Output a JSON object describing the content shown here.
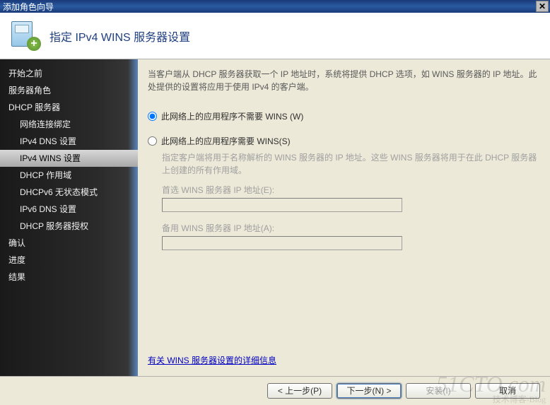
{
  "window": {
    "title": "添加角色向导"
  },
  "header": {
    "title": "指定 IPv4 WINS 服务器设置"
  },
  "sidebar": {
    "items": [
      {
        "label": "开始之前",
        "sub": false,
        "selected": false
      },
      {
        "label": "服务器角色",
        "sub": false,
        "selected": false
      },
      {
        "label": "DHCP 服务器",
        "sub": false,
        "selected": false
      },
      {
        "label": "网络连接绑定",
        "sub": true,
        "selected": false
      },
      {
        "label": "IPv4 DNS 设置",
        "sub": true,
        "selected": false
      },
      {
        "label": "IPv4 WINS 设置",
        "sub": true,
        "selected": true
      },
      {
        "label": "DHCP 作用域",
        "sub": true,
        "selected": false
      },
      {
        "label": "DHCPv6 无状态模式",
        "sub": true,
        "selected": false
      },
      {
        "label": "IPv6 DNS 设置",
        "sub": true,
        "selected": false
      },
      {
        "label": "DHCP 服务器授权",
        "sub": true,
        "selected": false
      },
      {
        "label": "确认",
        "sub": false,
        "selected": false
      },
      {
        "label": "进度",
        "sub": false,
        "selected": false
      },
      {
        "label": "结果",
        "sub": false,
        "selected": false
      }
    ]
  },
  "content": {
    "intro": "当客户端从 DHCP 服务器获取一个 IP 地址时，系统将提供 DHCP 选项，如 WINS 服务器的 IP 地址。此处提供的设置将应用于使用 IPv4 的客户端。",
    "radio1": "此网络上的应用程序不需要 WINS (W)",
    "radio2": "此网络上的应用程序需要 WINS(S)",
    "sub_desc": "指定客户端将用于名称解析的 WINS 服务器的 IP 地址。这些 WINS 服务器将用于在此 DHCP 服务器上创建的所有作用域。",
    "primary_label": "首选 WINS 服务器 IP 地址(E):",
    "primary_value": "",
    "alt_label": "备用 WINS 服务器 IP 地址(A):",
    "alt_value": "",
    "link": "有关 WINS 服务器设置的详细信息"
  },
  "footer": {
    "prev": "< 上一步(P)",
    "next": "下一步(N) >",
    "install": "安装(I)",
    "cancel": "取消"
  },
  "watermark": {
    "main": "51CTO.com",
    "sub": "技术博客-Blog"
  }
}
